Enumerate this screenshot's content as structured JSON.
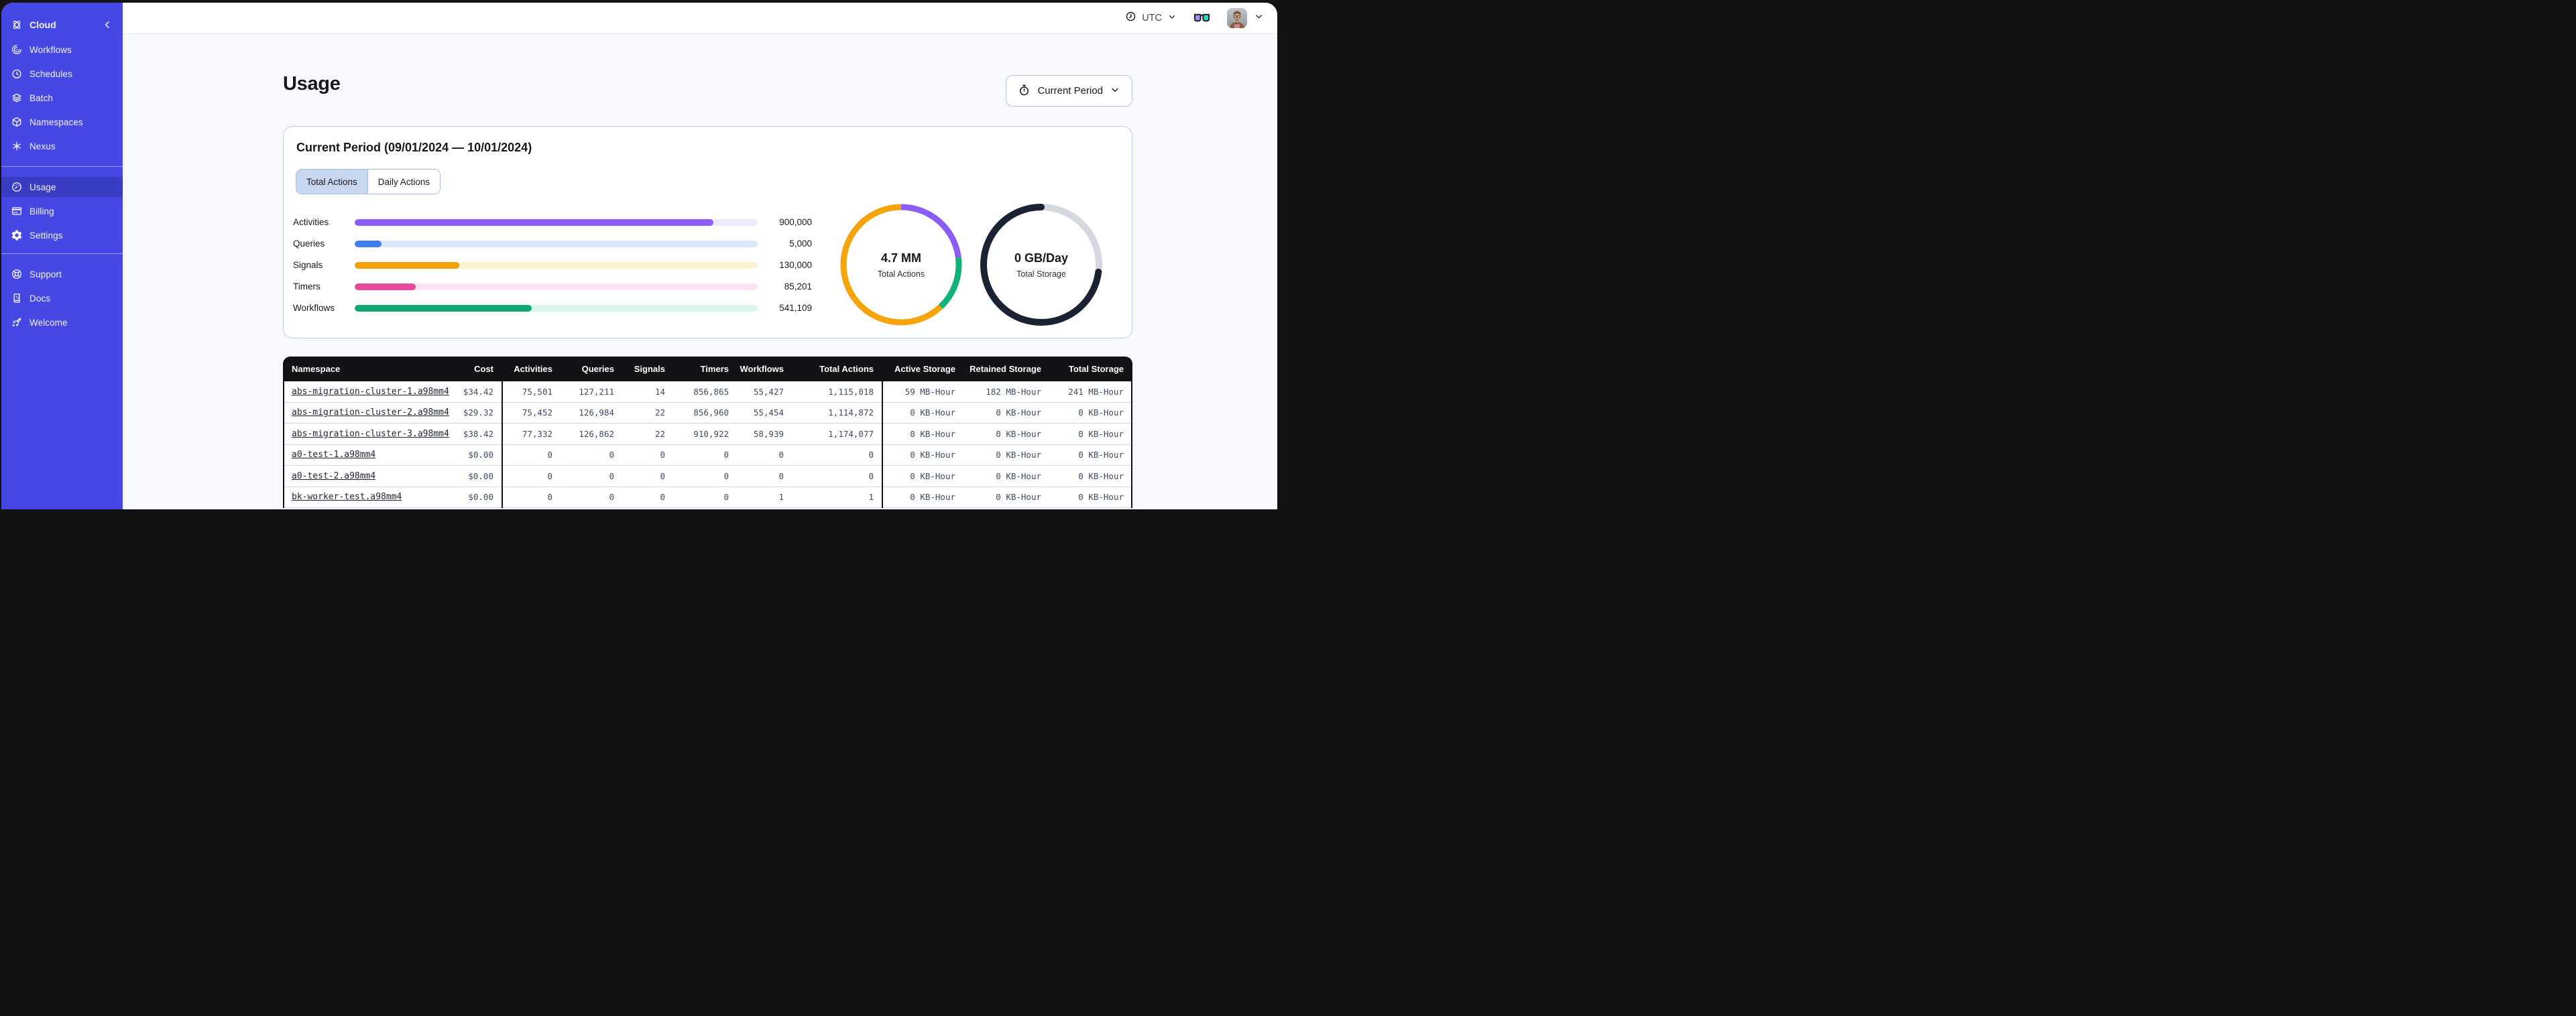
{
  "colors": {
    "sidebar_bg": "#4648E4",
    "sidebar_active_bg": "#3A3DC4",
    "table_header_bg": "#121216",
    "activities": "#8B5CF6",
    "queries": "#3F7FF0",
    "signals": "#F0A009",
    "timers": "#E8479B",
    "workflows": "#12A875",
    "storage_ring": "#1B2333",
    "storage_ring_rest": "#D5D8DE"
  },
  "sidebar": {
    "brand": {
      "label": "Cloud"
    },
    "nav_main": [
      {
        "label": "Workflows",
        "icon": "workflows"
      },
      {
        "label": "Schedules",
        "icon": "schedules"
      },
      {
        "label": "Batch",
        "icon": "batch"
      },
      {
        "label": "Namespaces",
        "icon": "namespaces"
      },
      {
        "label": "Nexus",
        "icon": "nexus"
      }
    ],
    "nav_account": [
      {
        "label": "Usage",
        "icon": "usage",
        "active": true
      },
      {
        "label": "Billing",
        "icon": "billing"
      },
      {
        "label": "Settings",
        "icon": "settings"
      }
    ],
    "nav_help": [
      {
        "label": "Support",
        "icon": "support"
      },
      {
        "label": "Docs",
        "icon": "docs"
      },
      {
        "label": "Welcome",
        "icon": "welcome"
      }
    ]
  },
  "topbar": {
    "timezone": "UTC"
  },
  "page": {
    "title": "Usage",
    "period_button_label": "Current Period"
  },
  "usage_card": {
    "title": "Current Period (09/01/2024 — 10/01/2024)",
    "tabs": [
      {
        "label": "Total Actions",
        "active": true
      },
      {
        "label": "Daily Actions",
        "active": false
      }
    ],
    "bars": [
      {
        "label": "Activities",
        "value": "900,000",
        "fraction": 0.89,
        "color": "#8B5CF6",
        "track_color": "#EEE9FC"
      },
      {
        "label": "Queries",
        "value": "5,000",
        "fraction": 0.066,
        "color": "#3F7FF0",
        "track_color": "#DBE8FB"
      },
      {
        "label": "Signals",
        "value": "130,000",
        "fraction": 0.26,
        "color": "#F0A009",
        "track_color": "#FBF2D0"
      },
      {
        "label": "Timers",
        "value": "85,201",
        "fraction": 0.152,
        "color": "#E8479B",
        "track_color": "#FBE3F4"
      },
      {
        "label": "Workflows",
        "value": "541,109",
        "fraction": 0.44,
        "color": "#12A875",
        "track_color": "#D8F6E8"
      }
    ],
    "donuts": [
      {
        "value": "4.7 MM",
        "label": "Total Actions",
        "segments": [
          {
            "color": "#8B5CF6",
            "fraction": 0.23
          },
          {
            "color": "#12B279",
            "fraction": 0.15
          },
          {
            "color": "#F5A40C",
            "fraction": 0.62
          }
        ]
      },
      {
        "value": "0 GB/Day",
        "label": "Total Storage",
        "segments": [
          {
            "color": "#D5D8DE",
            "fraction": 0.27
          },
          {
            "color": "#1B2333",
            "fraction": 0.73,
            "cap": true
          }
        ]
      }
    ]
  },
  "table": {
    "columns": [
      "Namespace",
      "Cost",
      "Activities",
      "Queries",
      "Signals",
      "Timers",
      "Workflows",
      "Total Actions",
      "Active Storage",
      "Retained Storage",
      "Total Storage"
    ],
    "rows": [
      [
        "abs-migration-cluster-1.a98mm4",
        "$34.42",
        "75,501",
        "127,211",
        "14",
        "856,865",
        "55,427",
        "1,115,018",
        "59 MB-Hour",
        "182 MB-Hour",
        "241 MB-Hour"
      ],
      [
        "abs-migration-cluster-2.a98mm4",
        "$29.32",
        "75,452",
        "126,984",
        "22",
        "856,960",
        "55,454",
        "1,114,872",
        "0 KB-Hour",
        "0 KB-Hour",
        "0 KB-Hour"
      ],
      [
        "abs-migration-cluster-3.a98mm4",
        "$38.42",
        "77,332",
        "126,862",
        "22",
        "910,922",
        "58,939",
        "1,174,077",
        "0 KB-Hour",
        "0 KB-Hour",
        "0 KB-Hour"
      ],
      [
        "a0-test-1.a98mm4",
        "$0.00",
        "0",
        "0",
        "0",
        "0",
        "0",
        "0",
        "0 KB-Hour",
        "0 KB-Hour",
        "0 KB-Hour"
      ],
      [
        "a0-test-2.a98mm4",
        "$0.00",
        "0",
        "0",
        "0",
        "0",
        "0",
        "0",
        "0 KB-Hour",
        "0 KB-Hour",
        "0 KB-Hour"
      ],
      [
        "bk-worker-test.a98mm4",
        "$0.00",
        "0",
        "0",
        "0",
        "0",
        "1",
        "1",
        "0 KB-Hour",
        "0 KB-Hour",
        "0 KB-Hour"
      ]
    ]
  }
}
